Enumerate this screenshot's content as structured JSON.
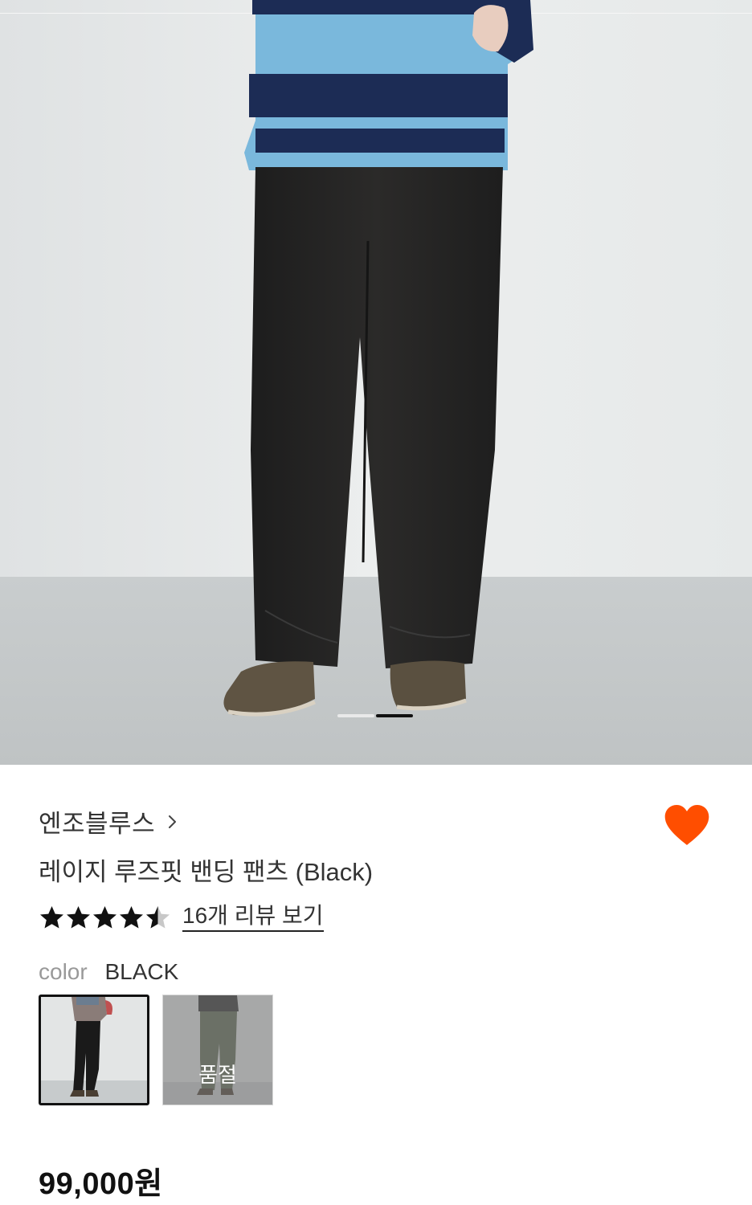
{
  "gallery": {
    "image_alt": "product-photo-wide-black-pants",
    "slide_count": 2,
    "active_slide": 2
  },
  "product": {
    "brand": "엔조블루스",
    "name": "레이지 루즈핏 밴딩 팬츠 (Black)",
    "rating": 4.5,
    "rating_max": 5,
    "review_link": "16개 리뷰 보기",
    "color_label": "color",
    "color_value": "BLACK",
    "swatches": [
      {
        "name": "black",
        "selected": true,
        "sold_out": false
      },
      {
        "name": "khaki",
        "selected": false,
        "sold_out": true,
        "badge": "품절"
      }
    ],
    "price": "99,000원"
  },
  "colors": {
    "wish_heart": "#ff4e00",
    "star": "#111111",
    "star_empty": "#c8c8c8"
  }
}
